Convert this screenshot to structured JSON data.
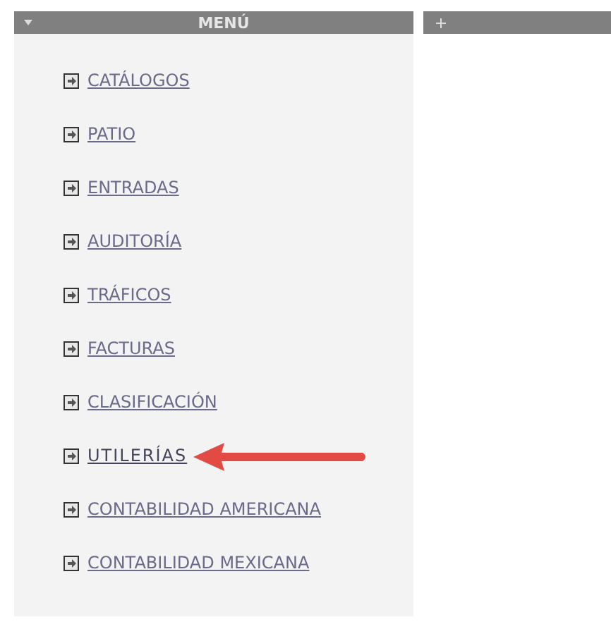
{
  "menu_panel": {
    "title": "MENÚ",
    "expanded": true,
    "items": [
      {
        "label": "CATÁLOGOS",
        "highlighted": false
      },
      {
        "label": "PATIO",
        "highlighted": false
      },
      {
        "label": "ENTRADAS",
        "highlighted": false
      },
      {
        "label": "AUDITORÍA",
        "highlighted": false
      },
      {
        "label": "TRÁFICOS",
        "highlighted": false
      },
      {
        "label": "FACTURAS",
        "highlighted": false
      },
      {
        "label": "CLASIFICACIÓN",
        "highlighted": false
      },
      {
        "label": "UTILERÍAS",
        "highlighted": true
      },
      {
        "label": "CONTABILIDAD AMERICANA",
        "highlighted": false
      },
      {
        "label": "CONTABILIDAD MEXICANA",
        "highlighted": false
      }
    ]
  },
  "side_panel": {
    "expanded": false
  }
}
